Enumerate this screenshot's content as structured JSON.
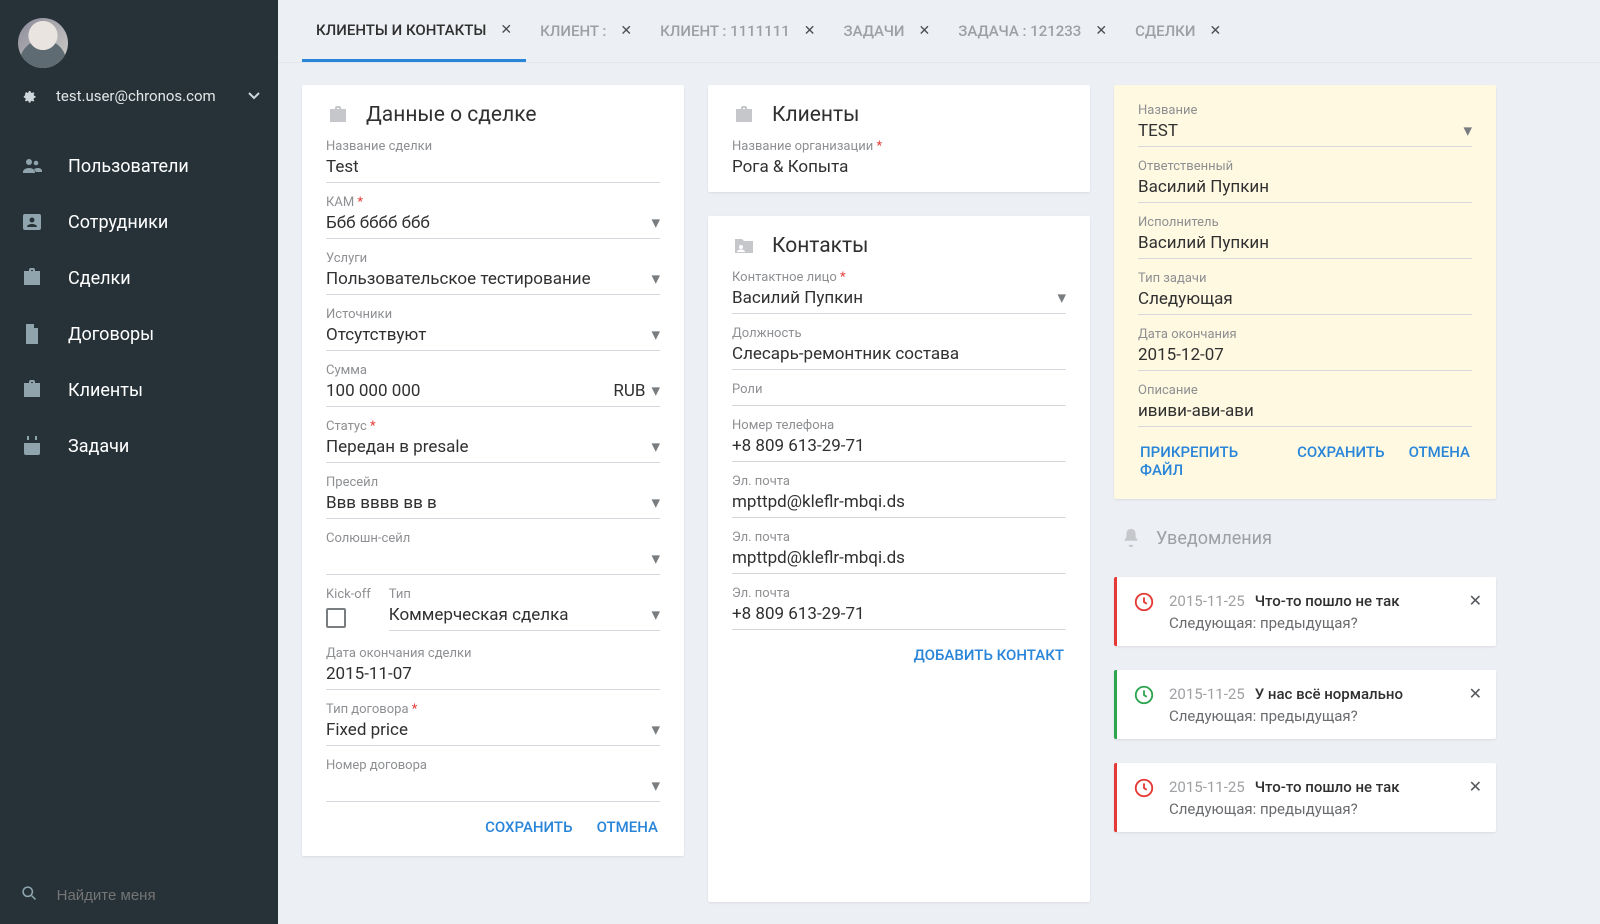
{
  "sidebar": {
    "user_email": "test.user@chronos.com",
    "search_placeholder": "Найдите меня",
    "items": [
      {
        "label": "Пользователи"
      },
      {
        "label": "Сотрудники"
      },
      {
        "label": "Сделки"
      },
      {
        "label": "Договоры"
      },
      {
        "label": "Клиенты"
      },
      {
        "label": "Задачи"
      }
    ]
  },
  "tabs": [
    {
      "label": "КЛИЕНТЫ И КОНТАКТЫ",
      "active": true
    },
    {
      "label": "КЛИЕНТ :"
    },
    {
      "label": "КЛИЕНТ : 1111111"
    },
    {
      "label": "ЗАДАЧИ"
    },
    {
      "label": "ЗАДАЧА : 121233"
    },
    {
      "label": "СДЕЛКИ"
    }
  ],
  "deal": {
    "title": "Данные о сделке",
    "name_label": "Название сделки",
    "name": "Test",
    "kam_label": "КАМ",
    "kam": "Ббб бббб ббб",
    "services_label": "Услуги",
    "services": "Пользовательское тестирование",
    "sources_label": "Источники",
    "sources": "Отсутствуют",
    "sum_label": "Сумма",
    "sum": "100 000 000",
    "currency": "RUB",
    "status_label": "Статус",
    "status": "Передан в presale",
    "presale_label": "Пресейл",
    "presale": "Ввв вввв вв в",
    "solution_label": "Солюшн-сейл",
    "solution": "",
    "kickoff_label": "Kick-off",
    "type_label": "Тип",
    "type": "Коммерческая сделка",
    "enddate_label": "Дата окончания сделки",
    "enddate": "2015-11-07",
    "contract_type_label": "Тип договора",
    "contract_type": "Fixed price",
    "contract_num_label": "Номер договора",
    "contract_num": "",
    "save": "СОХРАНИТЬ",
    "cancel": "ОТМЕНА"
  },
  "clients": {
    "title": "Клиенты",
    "org_label": "Название организации",
    "org": "Рога & Копыта"
  },
  "contacts": {
    "title": "Контакты",
    "person_label": "Контактное лицо",
    "person": "Василий Пупкин",
    "position_label": "Должность",
    "position": "Слесарь-ремонтник состава",
    "roles_label": "Роли",
    "roles": "",
    "phone_label": "Номер телефона",
    "phone": "+8 809 613-29-71",
    "email1_label": "Эл. почта",
    "email1": "mpttpd@kleflr-mbqi.ds",
    "email2_label": "Эл. почта",
    "email2": "mpttpd@kleflr-mbqi.ds",
    "email3_label": "Эл. почта",
    "email3": "+8 809 613-29-71",
    "add_contact": "ДОБАВИТЬ КОНТАКТ"
  },
  "task": {
    "name_label": "Название",
    "name": "TEST",
    "responsible_label": "Ответственный",
    "responsible": "Василий Пупкин",
    "executor_label": "Исполнитель",
    "executor": "Василий Пупкин",
    "type_label": "Тип задачи",
    "type": "Следующая",
    "enddate_label": "Дата окончания",
    "enddate": "2015-12-07",
    "desc_label": "Описание",
    "desc": "ививи-ави-ави",
    "attach": "ПРИКРЕПИТЬ ФАЙЛ",
    "save": "СОХРАНИТЬ",
    "cancel": "ОТМЕНА"
  },
  "notifications": {
    "title": "Уведомления",
    "items": [
      {
        "date": "2015-11-25",
        "title": "Что-то пошло не так",
        "sub": "Следующая: предыдущая?",
        "kind": "error"
      },
      {
        "date": "2015-11-25",
        "title": "У нас всё нормально",
        "sub": "Следующая: предыдущая?",
        "kind": "ok"
      },
      {
        "date": "2015-11-25",
        "title": "Что-то пошло не так",
        "sub": "Следующая: предыдущая?",
        "kind": "error"
      }
    ]
  }
}
